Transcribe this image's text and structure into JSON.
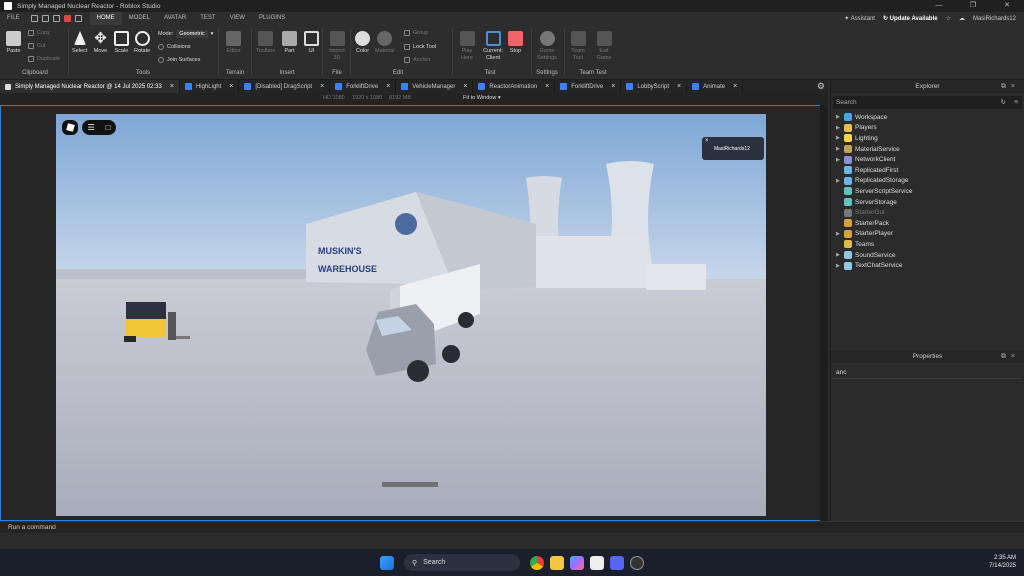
{
  "title_bar": {
    "text": "Simply Managed Nuclear Reactor - Roblox Studio"
  },
  "menu": {
    "file": "FILE",
    "tabs": [
      "HOME",
      "MODEL",
      "AVATAR",
      "TEST",
      "VIEW",
      "PLUGINS"
    ],
    "assistant": "Assistant",
    "update": "Update Available",
    "user": "MasiRichards12"
  },
  "ribbon": {
    "clipboard": {
      "paste": "Paste",
      "copy": "Copy",
      "cut": "Cut",
      "duplicate": "Duplicate",
      "label": "Clipboard"
    },
    "tools": {
      "select": "Select",
      "move": "Move",
      "scale": "Scale",
      "rotate": "Rotate",
      "label": "Tools",
      "mode_label": "Mode:",
      "mode_value": "Geometric",
      "collisions": "Collisions",
      "join_surfaces": "Join Surfaces"
    },
    "terrain": {
      "editor": "Editor",
      "label": "Terrain"
    },
    "insert": {
      "toolbox": "Toolbox",
      "part": "Part",
      "ui": "UI",
      "label": "Insert"
    },
    "file": {
      "import3d": "Import 3D",
      "label": "File"
    },
    "edit": {
      "color": "Color",
      "material": "Material",
      "group": "Group",
      "lock": "Lock Tool",
      "anchor": "Anchor",
      "label": "Edit"
    },
    "test": {
      "play": "Play Here",
      "current": "Current: Client",
      "stop": "Stop",
      "label": "Test"
    },
    "settings": {
      "game_settings": "Game Settings",
      "label": "Settings"
    },
    "team_test": {
      "team_test": "Team Test",
      "exit_game": "Exit Game",
      "label": "Team Test"
    }
  },
  "doc_tabs": [
    {
      "label": "Simply Managed Nuclear Reactor @ 14 Jul 2025 02:33"
    },
    {
      "label": "HighLight"
    },
    {
      "label": "[Disabled] DragScript"
    },
    {
      "label": "ForkliftDrive"
    },
    {
      "label": "VehicleManager"
    },
    {
      "label": "ReactorAnimation"
    },
    {
      "label": "ForkliftDrive"
    },
    {
      "label": "LobbyScript"
    },
    {
      "label": "Animate"
    }
  ],
  "viewport_info": {
    "res": "HD 1080",
    "size": "1920 x 1080",
    "mem": "8192 MB",
    "fit": "Fit to Window"
  },
  "scene": {
    "sign_line1": "MUSKIN'S",
    "sign_line2": "WAREHOUSE",
    "popup_user": "MasiRichards12"
  },
  "explorer": {
    "title": "Explorer",
    "search_placeholder": "Search",
    "items": [
      {
        "name": "Workspace",
        "color": "#4aa3df",
        "expand": true,
        "dim": false
      },
      {
        "name": "Players",
        "color": "#e7c04a",
        "expand": true,
        "dim": false
      },
      {
        "name": "Lighting",
        "color": "#f5d547",
        "expand": true,
        "dim": false
      },
      {
        "name": "MaterialService",
        "color": "#c4a25e",
        "expand": true,
        "dim": false
      },
      {
        "name": "NetworkClient",
        "color": "#8a8fd8",
        "expand": true,
        "dim": false
      },
      {
        "name": "ReplicatedFirst",
        "color": "#6cb3e8",
        "expand": false,
        "dim": false
      },
      {
        "name": "ReplicatedStorage",
        "color": "#6cb3e8",
        "expand": true,
        "dim": false
      },
      {
        "name": "ServerScriptService",
        "color": "#5ec3c3",
        "expand": false,
        "dim": false
      },
      {
        "name": "ServerStorage",
        "color": "#5ec3c3",
        "expand": false,
        "dim": false
      },
      {
        "name": "StarterGui",
        "color": "#777777",
        "expand": false,
        "dim": true
      },
      {
        "name": "StarterPack",
        "color": "#d6a23c",
        "expand": false,
        "dim": false
      },
      {
        "name": "StarterPlayer",
        "color": "#d6a23c",
        "expand": true,
        "dim": false
      },
      {
        "name": "Teams",
        "color": "#e0b84c",
        "expand": false,
        "dim": false
      },
      {
        "name": "SoundService",
        "color": "#8fc6e8",
        "expand": true,
        "dim": false
      },
      {
        "name": "TextChatService",
        "color": "#8fc6e8",
        "expand": true,
        "dim": false
      }
    ]
  },
  "properties": {
    "title": "Properties",
    "filter_value": "anc"
  },
  "command_bar": {
    "placeholder": "Run a command"
  },
  "taskbar": {
    "search": "Search",
    "time": "2:35 AM",
    "date": "7/14/2025"
  }
}
